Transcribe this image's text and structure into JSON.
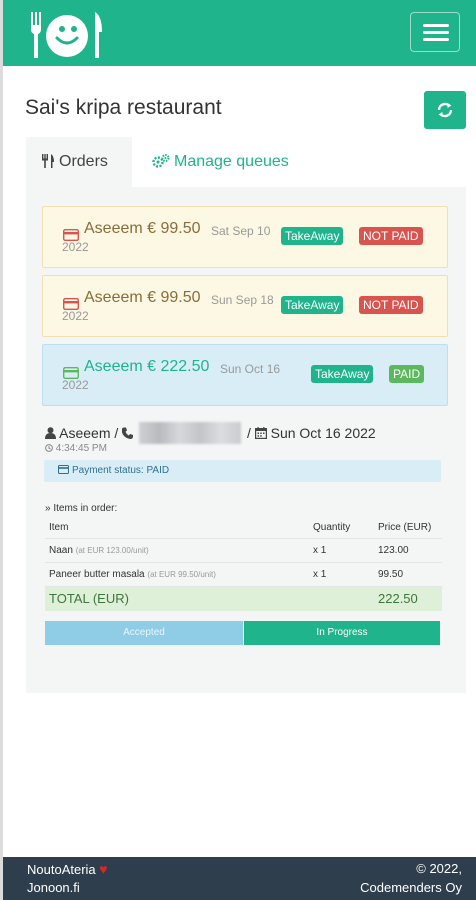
{
  "header": {
    "brand_icon": "fork-smiley-knife-logo",
    "menu_icon": "hamburger-menu-icon"
  },
  "page": {
    "title": "Sai's kripa restaurant",
    "refresh_icon": "refresh-icon"
  },
  "tabs": [
    {
      "label": "Orders",
      "icon": "cutlery-icon",
      "active": true
    },
    {
      "label": "Manage queues",
      "icon": "cogs-icon",
      "active": false
    }
  ],
  "orders": [
    {
      "name": "Aseeem € 99.50",
      "date": "Sat Sep 10",
      "year": "2022",
      "badges": [
        "TakeAway",
        "NOT PAID"
      ],
      "paid": false
    },
    {
      "name": "Aseeem € 99.50",
      "date": "Sun Sep 18",
      "year": "2022",
      "badges": [
        "TakeAway",
        "NOT PAID"
      ],
      "paid": false
    },
    {
      "name": "Aseeem € 222.50",
      "date": "Sun Oct 16",
      "year": "2022",
      "badges": [
        "TakeAway",
        "PAID"
      ],
      "paid": true
    }
  ],
  "detail": {
    "customer": "Aseeem /",
    "separator": "/",
    "date": "Sun Oct 16 2022",
    "time": "4:34:45 PM",
    "payment_status": "Payment status: PAID",
    "items_title": "» Items in order:",
    "columns": [
      "Item",
      "Quantity",
      "Price (EUR)"
    ],
    "items": [
      {
        "name": "Naan",
        "unit_note": "(at EUR 123.00/unit)",
        "qty": "x 1",
        "price": "123.00"
      },
      {
        "name": "Paneer butter masala",
        "unit_note": "(at EUR 99.50/unit)",
        "qty": "x 1",
        "price": "99.50"
      }
    ],
    "total_label": "TOTAL (EUR)",
    "total_value": "222.50",
    "buttons": {
      "accepted": "Accepted",
      "in_progress": "In Progress"
    }
  },
  "footer": {
    "brand": "NoutoAteria",
    "site": "Jonoon.fi",
    "copyright": "© 2022,",
    "company": "Codemenders Oy"
  },
  "colors": {
    "primary": "#1fb48c",
    "danger": "#d9534f",
    "success": "#5cb85c",
    "warning_bg": "#fcf8e3",
    "info_bg": "#d9edf7",
    "footer_bg": "#2f3e4c"
  }
}
